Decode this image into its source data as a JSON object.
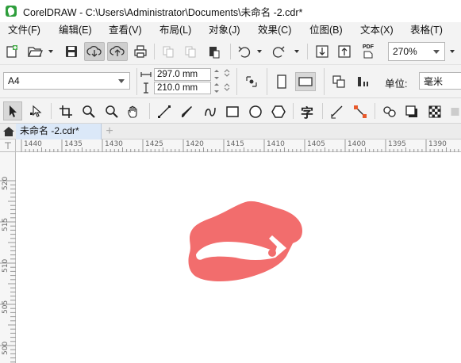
{
  "window": {
    "title": "CorelDRAW - C:\\Users\\Administrator\\Documents\\未命名 -2.cdr*"
  },
  "menu": [
    "文件(F)",
    "编辑(E)",
    "查看(V)",
    "布局(L)",
    "对象(J)",
    "效果(C)",
    "位图(B)",
    "文本(X)",
    "表格(T)"
  ],
  "toolbar": {
    "zoom_value": "270%",
    "icons": [
      "new-document-icon",
      "open-icon",
      "save-icon",
      "cloud-download-icon",
      "cloud-upload-icon",
      "print-icon",
      "cut-icon",
      "copy-icon",
      "paste-icon",
      "undo-icon",
      "redo-icon",
      "import-icon",
      "export-icon",
      "publish-pdf-icon"
    ],
    "pdf_text": "PDF"
  },
  "property_bar": {
    "page_size": "A4",
    "width": "297.0 mm",
    "height": "210.0 mm",
    "units_label": "单位:",
    "units_value": "毫米"
  },
  "toolbox": {
    "icons": [
      "pick-tool-icon",
      "shape-tool-icon",
      "crop-tool-icon",
      "zoom-tool-icon",
      "zoom-out-icon",
      "pan-tool-icon",
      "freehand-tool-icon",
      "artistic-media-icon",
      "bezier-tool-icon",
      "rectangle-tool-icon",
      "ellipse-tool-icon",
      "polygon-tool-icon",
      "text-tool-icon",
      "parallel-dimension-icon",
      "connector-tool-icon",
      "blend-tool-icon",
      "drop-shadow-icon",
      "transparency-icon"
    ],
    "text_tool_glyph": "字"
  },
  "tabs": {
    "document": "未命名 -2.cdr*",
    "add": "+"
  },
  "ruler": {
    "h_labels": [
      "1440",
      "1435",
      "1430",
      "1425",
      "1420",
      "1415",
      "1410",
      "1405",
      "1400",
      "1395",
      "1390"
    ],
    "v_labels": [
      "520",
      "515",
      "510",
      "505",
      "500"
    ]
  },
  "canvas": {
    "object_color": "#f26d6d"
  }
}
